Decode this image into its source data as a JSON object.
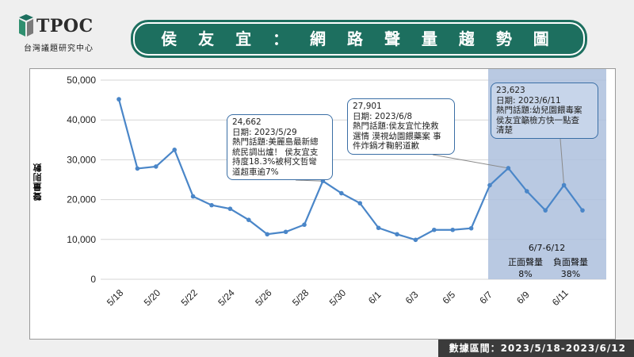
{
  "header": {
    "logo_text": "TPOC",
    "logo_sub": "台灣議題研究中心",
    "title": "侯 友 宜 ： 網 路 聲 量 趨 勢 圖"
  },
  "footer": {
    "text": "數據區間：2023/5/18-2023/6/12"
  },
  "colors": {
    "line": "#4a86c8",
    "highlight": "#adbfdd",
    "brand": "#1d6f5f"
  },
  "chart_data": {
    "type": "line",
    "ylabel": "聲量則數",
    "ylim": [
      0,
      50000
    ],
    "yticks": [
      "0",
      "10,000",
      "20,000",
      "30,000",
      "40,000",
      "50,000"
    ],
    "xtick_labels": [
      "5/18",
      "5/20",
      "5/22",
      "5/24",
      "5/26",
      "5/28",
      "5/30",
      "6/1",
      "6/3",
      "6/5",
      "6/7",
      "6/9",
      "6/11"
    ],
    "x": [
      "5/18",
      "5/19",
      "5/20",
      "5/21",
      "5/22",
      "5/23",
      "5/24",
      "5/25",
      "5/26",
      "5/27",
      "5/28",
      "5/29",
      "5/30",
      "5/31",
      "6/1",
      "6/2",
      "6/3",
      "6/4",
      "6/5",
      "6/6",
      "6/7",
      "6/8",
      "6/9",
      "6/10",
      "6/11",
      "6/12"
    ],
    "values": [
      45200,
      27800,
      28300,
      32500,
      20800,
      18600,
      17700,
      14900,
      11300,
      11900,
      13700,
      24662,
      21600,
      19100,
      12900,
      11300,
      9900,
      12400,
      12400,
      12800,
      23600,
      27901,
      22100,
      17300,
      23623,
      17300
    ],
    "highlight_range": {
      "from": "6/7",
      "to": "6/12",
      "label": "6/7-6/12"
    },
    "sentiment": [
      {
        "label": "正面聲量",
        "value": "8%"
      },
      {
        "label": "負面聲量",
        "value": "38%"
      }
    ],
    "annotations": [
      {
        "x": "5/29",
        "value": "24,662",
        "date": "日期: 2023/5/29",
        "topic": "熱門話題:美麗島最新總\n統民調出爐！ 侯友宜支\n持度18.3%被柯文哲彎\n道超車逾7%"
      },
      {
        "x": "6/8",
        "value": "27,901",
        "date": "日期: 2023/6/8",
        "topic": "熱門話題:侯友宜忙挽救\n選情 漠視幼園餵藥案 事\n件炸鍋才鞠躬道歉"
      },
      {
        "x": "6/11",
        "value": "23,623",
        "date": "日期: 2023/6/11",
        "topic": "熱門話題:幼兒園餵毒案\n侯友宜籲檢方快一點查\n清楚"
      }
    ]
  }
}
